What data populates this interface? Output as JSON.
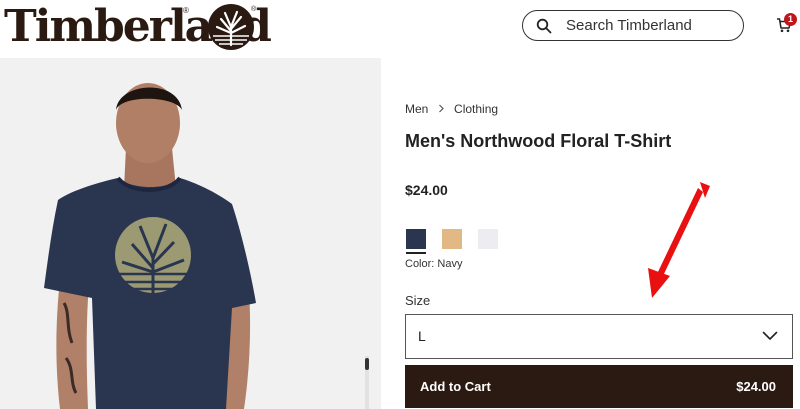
{
  "brand": {
    "name": "Timberland",
    "registered_mark": "®"
  },
  "search": {
    "placeholder": "Search Timberland"
  },
  "cart": {
    "count": "1"
  },
  "breadcrumb": [
    "Men",
    "Clothing"
  ],
  "product": {
    "title": "Men's Northwood Floral T-Shirt",
    "price": "$24.00"
  },
  "colors": {
    "swatches": [
      {
        "name": "navy",
        "hex": "#2a3550"
      },
      {
        "name": "tan",
        "hex": "#e2b985"
      },
      {
        "name": "white",
        "hex": "#ececf1"
      }
    ],
    "label": "Color: Navy",
    "selected": "navy"
  },
  "size": {
    "label": "Size",
    "selected": "L"
  },
  "add_to_cart": {
    "label": "Add to Cart",
    "price": "$24.00"
  },
  "theme": {
    "brand_brown": "#2b1a12",
    "badge_red": "#c0161b",
    "annotation_arrow": "#e81010"
  },
  "icons": [
    "search-icon",
    "cart-icon",
    "chevron-down-icon",
    "chevron-right-icon",
    "tree-logo-icon",
    "annotation-arrow-icon"
  ]
}
